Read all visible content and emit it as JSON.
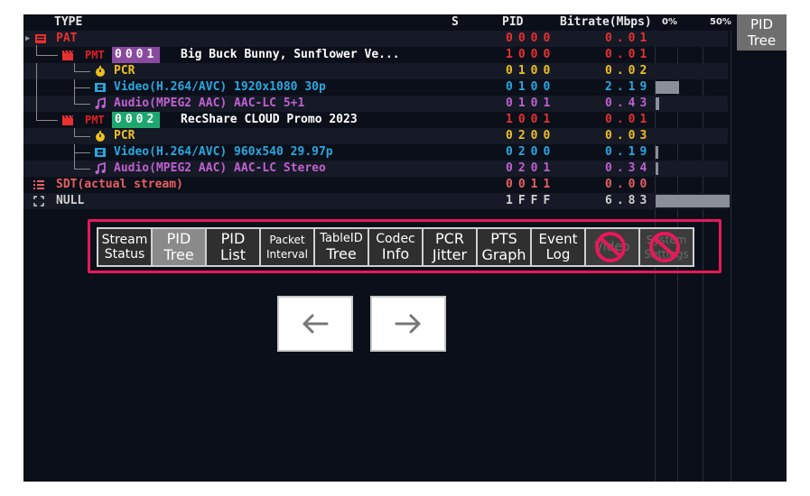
{
  "header": {
    "type": "TYPE",
    "s": "S",
    "pid": "PID",
    "bitrate": "Bitrate(Mbps)",
    "scale_0": "0%",
    "scale_50": "50%"
  },
  "view_button": {
    "line1": "PID",
    "line2": "Tree"
  },
  "rows": [
    {
      "label": "PAT",
      "pid": "0000",
      "bitrate": "0.01",
      "bar_fraction": 0
    },
    {
      "tag": "PMT",
      "number": "0001",
      "label": "Big Buck Bunny, Sunflower Ve...",
      "pid": "1000",
      "bitrate": "0.01",
      "bar_fraction": 0
    },
    {
      "label": "PCR",
      "pid": "0100",
      "bitrate": "0.02",
      "bar_fraction": 0
    },
    {
      "label": "Video(H.264/AVC) 1920x1080 30p",
      "pid": "0100",
      "bitrate": "2.19",
      "bar_fraction": 0.32
    },
    {
      "label": "Audio(MPEG2 AAC) AAC-LC 5+1",
      "pid": "0101",
      "bitrate": "0.43",
      "bar_fraction": 0.05
    },
    {
      "tag": "PMT",
      "number": "0002",
      "label": "RecShare CLOUD Promo 2023",
      "pid": "1001",
      "bitrate": "0.01",
      "bar_fraction": 0
    },
    {
      "label": "PCR",
      "pid": "0200",
      "bitrate": "0.03",
      "bar_fraction": 0
    },
    {
      "label": "Video(H.264/AVC) 960x540 29.97p",
      "pid": "0200",
      "bitrate": "0.19",
      "bar_fraction": 0.02
    },
    {
      "label": "Audio(MPEG2 AAC) AAC-LC Stereo",
      "pid": "0201",
      "bitrate": "0.34",
      "bar_fraction": 0.04
    },
    {
      "label": "SDT(actual stream)",
      "pid": "0011",
      "bitrate": "0.00",
      "bar_fraction": 0
    },
    {
      "label": "NULL",
      "pid": "1FFF",
      "bitrate": "6.83",
      "bar_fraction": 1.0
    }
  ],
  "toolbar": {
    "stream_status": {
      "line1": "Stream",
      "line2": "Status"
    },
    "pid_tree": {
      "line1": "PID",
      "line2": "Tree"
    },
    "pid_list": {
      "line1": "PID",
      "line2": "List"
    },
    "packet_interval": {
      "line1": "Packet",
      "line2": "Interval"
    },
    "tableid_tree": {
      "line1": "TableID",
      "line2": "Tree"
    },
    "codec_info": {
      "line1": "Codec",
      "line2": "Info"
    },
    "pcr_jitter": {
      "line1": "PCR",
      "line2": "Jitter"
    },
    "pts_graph": {
      "line1": "PTS",
      "line2": "Graph"
    },
    "event_log": {
      "line1": "Event",
      "line2": "Log"
    },
    "video": {
      "line1": "Video",
      "line2": ""
    },
    "system_settings": {
      "line1": "System",
      "line2": "Settings"
    }
  },
  "colors": {
    "red": "#e83030",
    "yellow": "#f0c020",
    "cyan": "#28a8e0",
    "purple": "#c060d0",
    "white": "#ffffff",
    "pink_frame": "#e8185a",
    "pmt1_box": "#8a4aa0",
    "pmt2_box": "#1ea870"
  }
}
